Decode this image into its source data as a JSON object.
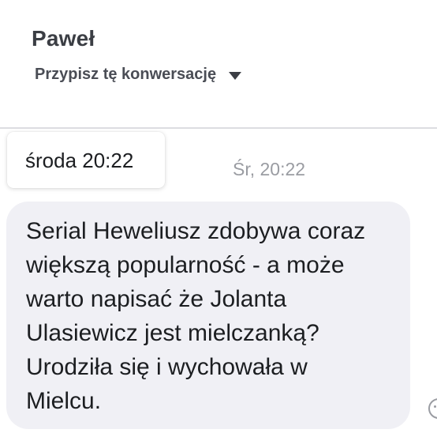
{
  "header": {
    "contact_name": "Paweł",
    "assign_label": "Przypisz tę konwersację"
  },
  "message": {
    "tooltip_time": "środa 20:22",
    "timestamp": "Śr, 20:22",
    "text": "Serial Heweliusz zdobywa coraz\nwiększą popularność - a może\nwarto napisać że Jolanta\nUlasiewicz jest mielczanką?\nUrodziła się i wychowała w\nMielcu."
  },
  "icons": {
    "assign_dropdown": "caret-down-icon",
    "reaction": "emoji-reaction-icon"
  },
  "colors": {
    "bubble_background": "#f0f0f5",
    "header_divider": "#dcdde1",
    "timestamp_text": "#9a9ca2"
  }
}
